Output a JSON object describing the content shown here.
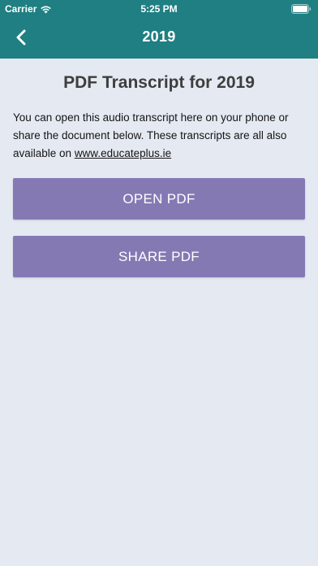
{
  "status_bar": {
    "carrier": "Carrier",
    "time": "5:25 PM"
  },
  "nav": {
    "title": "2019",
    "back_icon": "chevron-left-icon"
  },
  "main": {
    "title": "PDF Transcript for 2019",
    "description": "You can open this audio transcript here on your phone or share the document below. These transcripts are all also available on ",
    "link_text": "www.educateplus.ie",
    "open_button": "OPEN PDF",
    "share_button": "SHARE PDF"
  },
  "colors": {
    "header": "#1f7f82",
    "background": "#e4e9f2",
    "button": "#8579b4"
  }
}
